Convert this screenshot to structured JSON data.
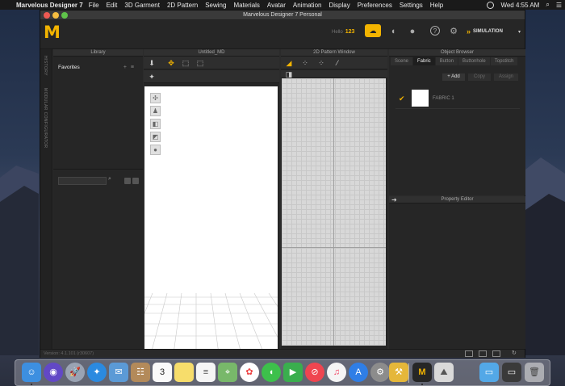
{
  "menubar": {
    "app": "Marvelous Designer 7",
    "items": [
      "File",
      "Edit",
      "3D Garment",
      "2D Pattern",
      "Sewing",
      "Materials",
      "Avatar",
      "Animation",
      "Display",
      "Preferences",
      "Settings",
      "Help"
    ],
    "clock": "Wed 4:55 AM"
  },
  "window": {
    "title": "Marvelous Designer 7 Personal"
  },
  "toolbar": {
    "logo": "M",
    "hello": "Hello",
    "hello_count": "123",
    "simulation": "SIMULATION"
  },
  "sidebar_strip": {
    "history": "HISTORY",
    "modular": "MODULAR CONFIGURATOR"
  },
  "library": {
    "header": "Library",
    "favorites": "Favorites"
  },
  "view3d": {
    "header": "Untitled_MD"
  },
  "view2d": {
    "header": "2D Pattern Window"
  },
  "object_browser": {
    "header": "Object Browser",
    "tabs": [
      "Scene",
      "Fabric",
      "Button",
      "Buttonhole",
      "Topstitch"
    ],
    "active_tab": "Fabric",
    "buttons": {
      "add": "+ Add",
      "copy": "Copy",
      "assign": "Assign"
    },
    "fabric": {
      "name": "FABRIC 1",
      "color": "#ffffff"
    }
  },
  "property_editor": {
    "header": "Property Editor"
  },
  "status": {
    "version": "Version: 4.1.101 (r30607)"
  },
  "colors": {
    "accent": "#f3b400",
    "panel": "#262626"
  },
  "dock": [
    "finder-icon",
    "siri-icon",
    "launchpad-icon",
    "safari-icon",
    "mail-icon",
    "contacts-icon",
    "calendar-icon",
    "notes-icon",
    "reminders-icon",
    "maps-icon",
    "photos-icon",
    "messages-icon",
    "facetime-icon",
    "news-icon",
    "music-icon",
    "appstore-icon",
    "settings-icon",
    "marvelous-icon",
    "marvelous-md-icon",
    "preview-icon",
    "downloads-folder-icon",
    "screenshot-icon",
    "trash-icon"
  ],
  "calendar_day": "3"
}
